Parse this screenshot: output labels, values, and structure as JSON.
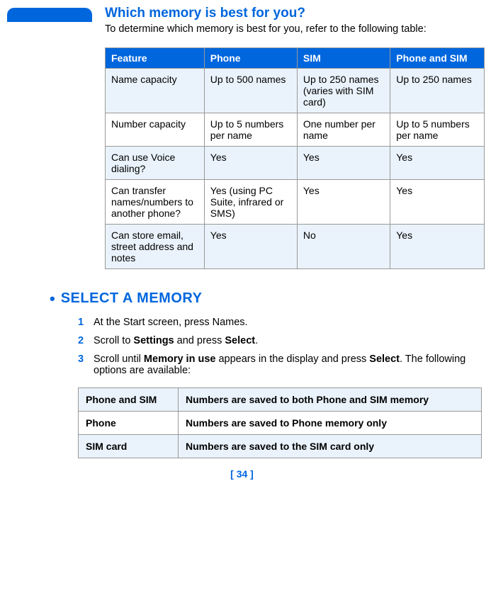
{
  "header": {
    "title": "Which memory is best for you?",
    "intro": "To determine which memory is best for you, refer to the following table:"
  },
  "table1": {
    "headers": [
      "Feature",
      "Phone",
      "SIM",
      "Phone and SIM"
    ],
    "rows": [
      {
        "feature": "Name capacity",
        "phone": "Up to 500 names",
        "sim": "Up to 250 names (varies with SIM card)",
        "both": "Up to 250 names"
      },
      {
        "feature": "Number capacity",
        "phone": "Up to 5 numbers per name",
        "sim": "One number per name",
        "both": "Up to 5 numbers per name"
      },
      {
        "feature": "Can use Voice dialing?",
        "phone": "Yes",
        "sim": "Yes",
        "both": "Yes"
      },
      {
        "feature": "Can transfer names/numbers to another phone?",
        "phone": "Yes (using PC Suite, infrared or SMS)",
        "sim": "Yes",
        "both": "Yes"
      },
      {
        "feature": "Can store email, street address and notes",
        "phone": "Yes",
        "sim": "No",
        "both": "Yes"
      }
    ]
  },
  "sub": {
    "bullet": "•",
    "heading": "SELECT A MEMORY"
  },
  "steps": [
    {
      "num": "1",
      "parts": [
        "At the Start screen, press Names."
      ]
    },
    {
      "num": "2",
      "parts": [
        "Scroll to ",
        "Settings",
        " and press ",
        "Select",
        "."
      ]
    },
    {
      "num": "3",
      "parts": [
        "Scroll until ",
        "Memory in use",
        " appears in the display and press ",
        "Select",
        ". The following options are available:"
      ]
    }
  ],
  "table2": {
    "rows": [
      {
        "name": "Phone and SIM",
        "desc": "Numbers are saved to both Phone and SIM memory"
      },
      {
        "name": "Phone",
        "desc": "Numbers are saved to Phone memory only"
      },
      {
        "name": "SIM card",
        "desc": "Numbers are saved to the SIM card only"
      }
    ]
  },
  "footer": {
    "page": "[ 34 ]"
  }
}
